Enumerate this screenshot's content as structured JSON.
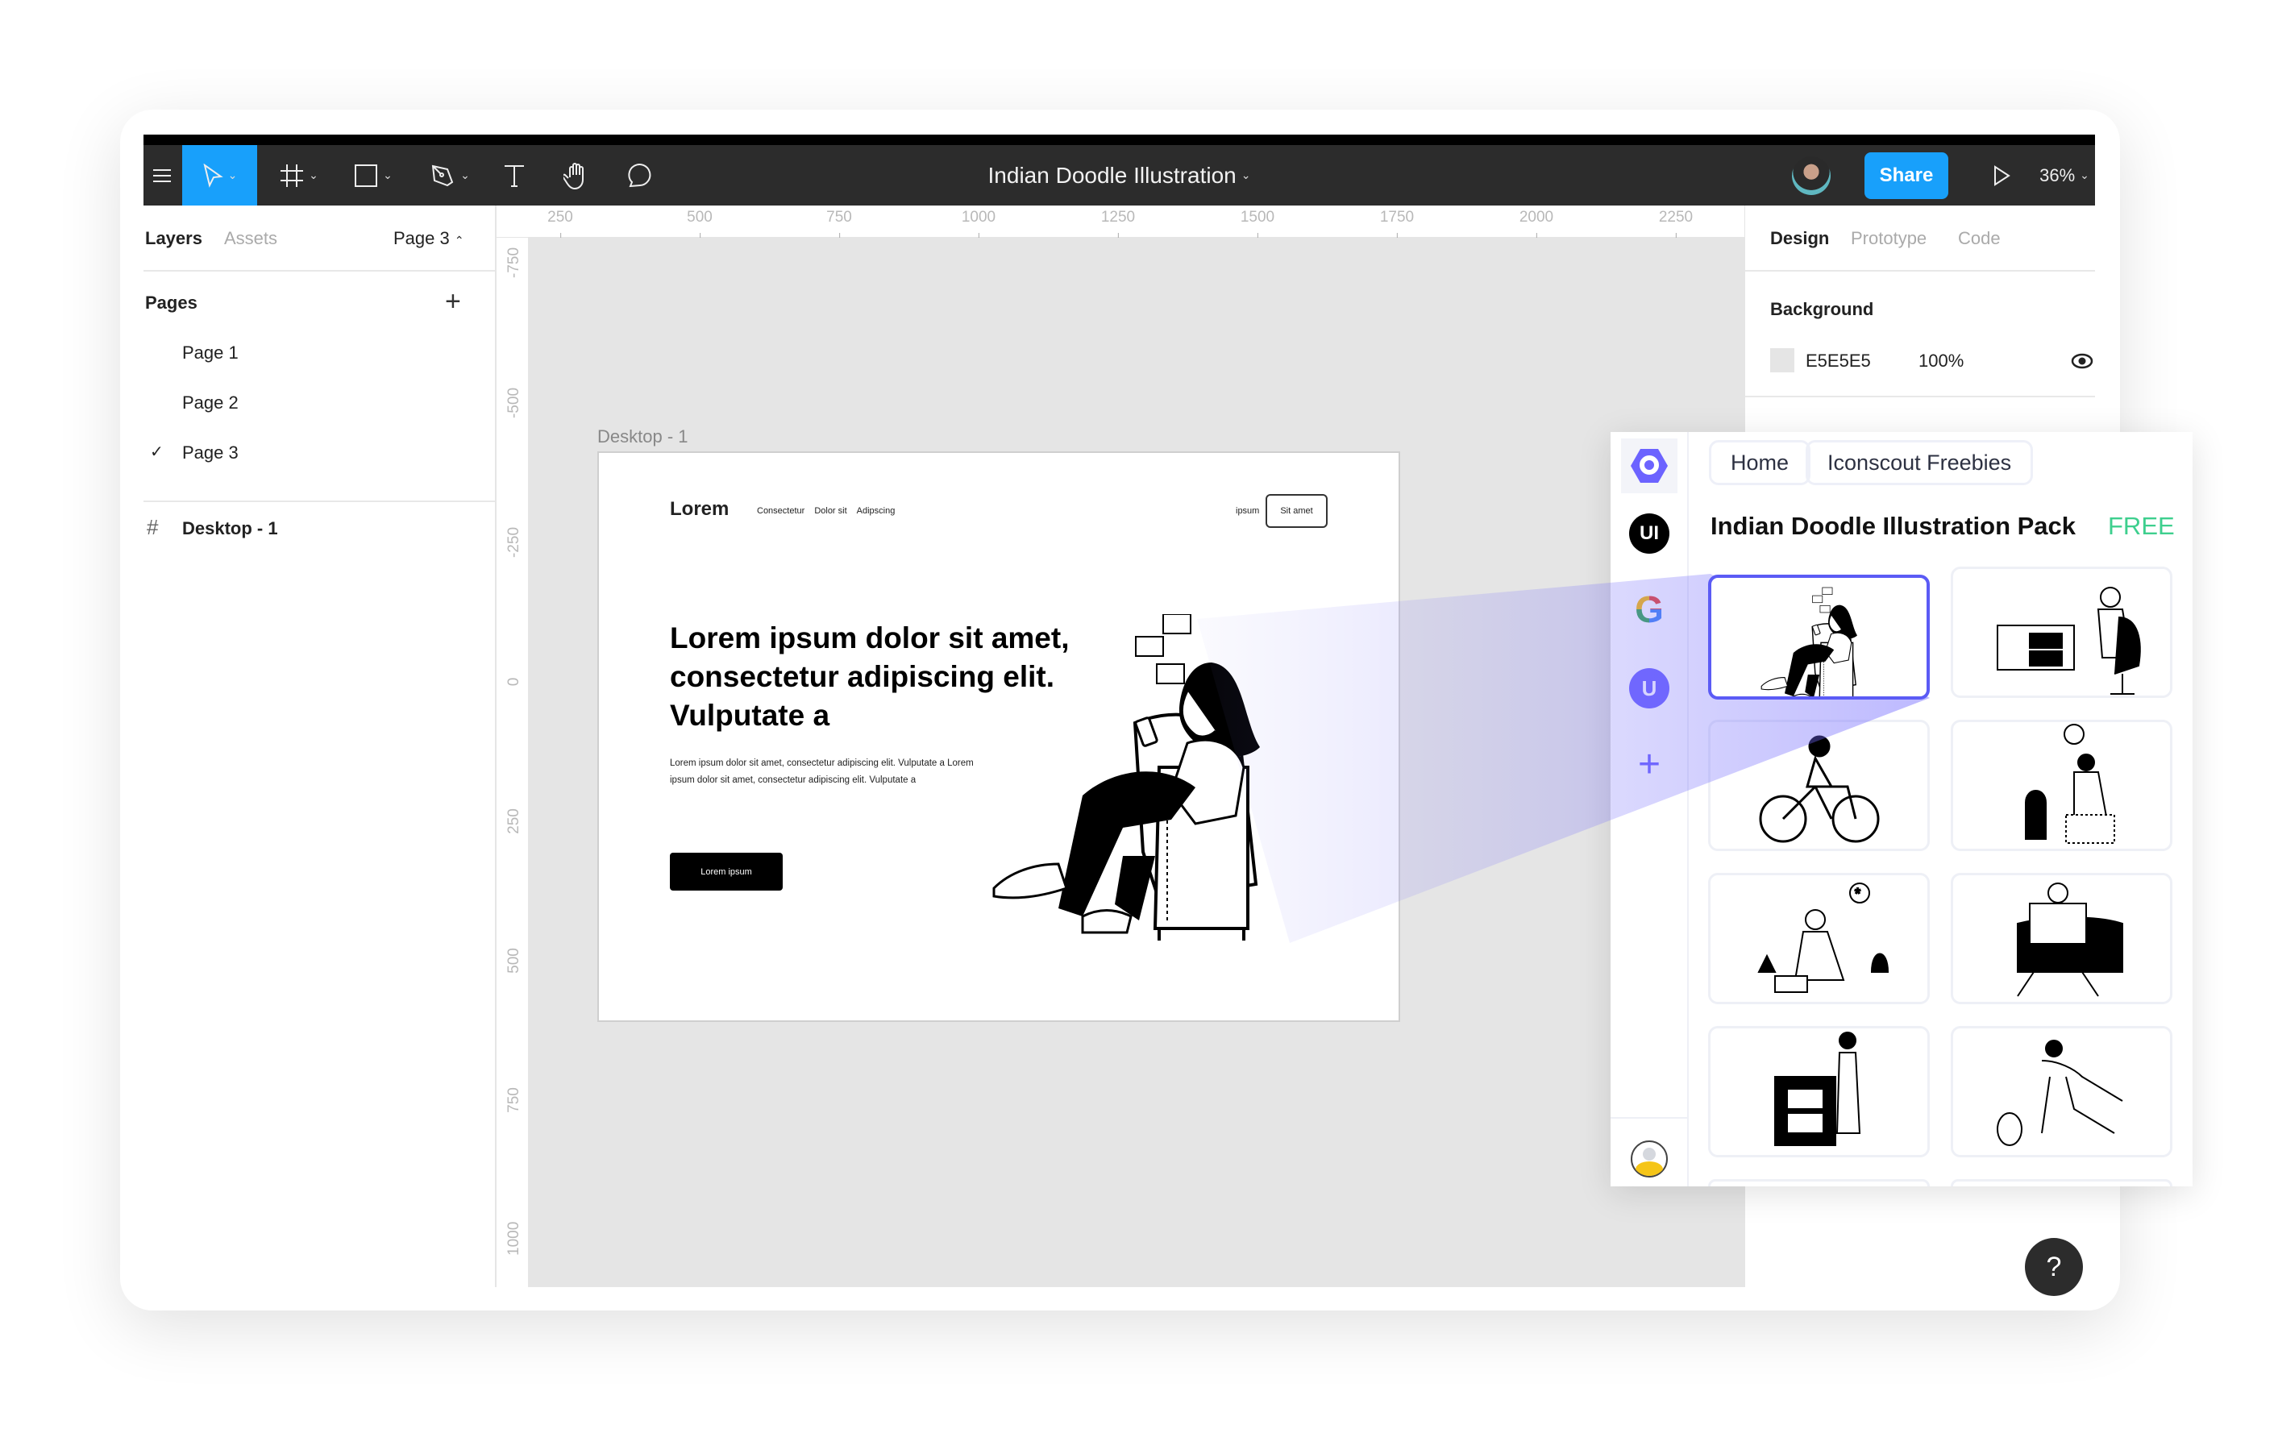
{
  "toolbar": {
    "file_title": "Indian Doodle Illustration",
    "share_label": "Share",
    "zoom": "36%",
    "tools": [
      "menu-icon",
      "move-icon",
      "frame-icon",
      "rectangle-icon",
      "pen-icon",
      "text-icon",
      "hand-icon",
      "comment-icon"
    ]
  },
  "left_panel": {
    "tabs": [
      "Layers",
      "Assets"
    ],
    "current_page": "Page 3",
    "pages_heading": "Pages",
    "pages": [
      {
        "label": "Page 1",
        "selected": false
      },
      {
        "label": "Page 2",
        "selected": false
      },
      {
        "label": "Page 3",
        "selected": true
      }
    ],
    "layers": [
      {
        "label": "Desktop - 1",
        "icon": "frame-icon"
      }
    ]
  },
  "rulers": {
    "horizontal": [
      "250",
      "500",
      "750",
      "1000",
      "1250",
      "1500",
      "1750",
      "2000",
      "2250"
    ],
    "vertical": [
      "-750",
      "-500",
      "-250",
      "0",
      "250",
      "500",
      "750",
      "1000"
    ]
  },
  "canvas": {
    "background": "#E5E5E5",
    "frame_label": "Desktop - 1",
    "frame": {
      "logo": "Lorem",
      "nav": [
        "Consectetur",
        "Dolor sit",
        "Adipscing"
      ],
      "nav_right_link": "ipsum",
      "nav_button": "Sit amet",
      "heading_lines": [
        "Lorem ipsum dolor sit amet,",
        "consectetur adipiscing elit.",
        "Vulputate a"
      ],
      "paragraph_lines": [
        "Lorem ipsum dolor sit amet, consectetur adipiscing elit. Vulputate a Lorem",
        "ipsum dolor sit amet, consectetur adipiscing elit. Vulputate a"
      ],
      "cta": "Lorem ipsum"
    }
  },
  "right_panel": {
    "tabs": [
      {
        "label": "Design",
        "active": true
      },
      {
        "label": "Prototype",
        "active": false
      },
      {
        "label": "Code",
        "active": false
      }
    ],
    "background_heading": "Background",
    "background_color": "E5E5E5",
    "background_opacity": "100%"
  },
  "plugin": {
    "rail": [
      "iconscout-logo",
      "ui-logo",
      "google-logo",
      "u-logo",
      "add-icon",
      "user-avatar"
    ],
    "breadcrumbs": [
      "Home",
      "Iconscout Freebies"
    ],
    "pack_title": "Indian Doodle Illustration Pack",
    "price_badge": "FREE",
    "colors": {
      "accent": "#6c63ff",
      "free": "#3ecf8e",
      "selected_border": "#5b5bf5"
    },
    "items": [
      "woman-in-armchair-with-phone",
      "man-at-desk",
      "cyclist",
      "woman-with-cat",
      "gardener",
      "man-reading-newspaper",
      "woman-with-dj-console",
      "woman-playing-tennis"
    ],
    "selected_index": 0
  },
  "help_label": "?"
}
